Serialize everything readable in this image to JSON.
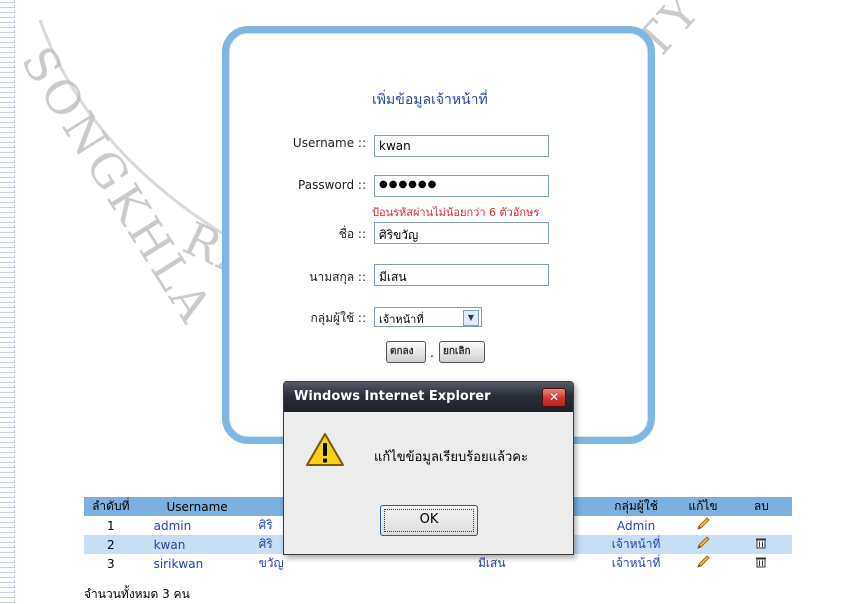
{
  "form": {
    "title": "เพิ่มข้อมูลเจ้าหน้าที่",
    "username_label": "Username ::",
    "username_value": "kwan",
    "password_label": "Password ::",
    "password_value": "●●●●●●",
    "password_hint": "ป้อนรหัสผ่านไม่น้อยกว่า 6 ตัวอักษร",
    "firstname_label": "ชื่อ ::",
    "firstname_value": "ศิริขวัญ",
    "lastname_label": "นามสกุล ::",
    "lastname_value": "มีเสน",
    "group_label": "กลุ่มผู้ใช้ ::",
    "group_value": "เจ้าหน้าที่",
    "submit_label": "ตกลง",
    "separator": ".",
    "cancel_label": "ยกเลิก"
  },
  "table": {
    "headers": [
      "ลำดับที่",
      "Username",
      "",
      "",
      "กลุ่มผู้ใช้",
      "แก้ไข",
      "ลบ"
    ],
    "rows": [
      {
        "no": "1",
        "username": "admin",
        "firstname": "ศิริ",
        "lastname": "",
        "group": "Admin"
      },
      {
        "no": "2",
        "username": "kwan",
        "firstname": "ศิริ",
        "lastname": "",
        "group": "เจ้าหน้าที่"
      },
      {
        "no": "3",
        "username": "sirikwan",
        "firstname": "ขวัญ",
        "lastname": "มีเสน",
        "group": "เจ้าหน้าที่"
      }
    ],
    "total": "จำนวนทั้งหมด 3 คน"
  },
  "dialog": {
    "title": "Windows Internet Explorer",
    "message": "แก้ไขข้อมูลเรียบร้อยแล้วคะ",
    "ok_label": "OK",
    "close_glyph": "✕"
  },
  "icons": {
    "warning": "warning-icon",
    "edit": "pencil-icon",
    "delete": "trash-icon",
    "dropdown": "chevron-down-icon"
  },
  "colors": {
    "panel_border": "#7fb6e2",
    "table_header": "#7bb0e0",
    "table_alt_row": "#c8def4",
    "hint_red": "#e0262e",
    "title_blue": "#2b4a9a"
  },
  "watermark": {
    "text_left": "SONGKHLA RAJABHAT",
    "text_right": "UNIVERSITY"
  }
}
